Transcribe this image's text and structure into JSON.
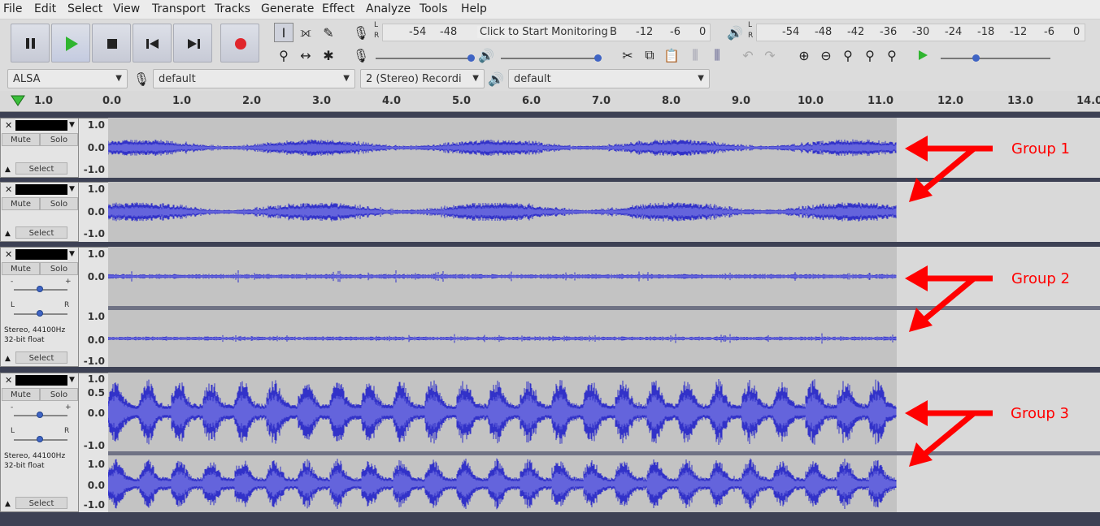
{
  "menu": [
    "File",
    "Edit",
    "Select",
    "View",
    "Transport",
    "Tracks",
    "Generate",
    "Effect",
    "Analyze",
    "Tools",
    "Help"
  ],
  "transport": [
    "pause",
    "play",
    "stop",
    "skip-start",
    "skip-end",
    "record"
  ],
  "meters": {
    "record_scale": [
      "-54",
      "-48",
      "Click to Start Monitoring",
      "-12",
      "-6",
      "0"
    ],
    "playback_scale": [
      "-54",
      "-48",
      "-42",
      "-36",
      "-30",
      "-24",
      "-18",
      "-12",
      "-6",
      "0"
    ],
    "lr": [
      "L",
      "R"
    ]
  },
  "devices": {
    "host": "ALSA",
    "record_device": "default",
    "channels": "2 (Stereo) Recordi",
    "playback_device": "default"
  },
  "ruler_ticks": [
    "1.0",
    "0.0",
    "1.0",
    "2.0",
    "3.0",
    "4.0",
    "5.0",
    "6.0",
    "7.0",
    "8.0",
    "9.0",
    "10.0",
    "11.0",
    "12.0",
    "13.0",
    "14.0"
  ],
  "track_panel": {
    "mute": "Mute",
    "solo": "Solo",
    "select": "Select",
    "gain_minus": "-",
    "gain_plus": "+",
    "pan_l": "L",
    "pan_r": "R",
    "info_line1": "Stereo, 44100Hz",
    "info_line2": "32-bit float"
  },
  "scale_labels": {
    "one": "1.0",
    "zero": "0.0",
    "minus": "-1.0",
    "half": "0.5"
  },
  "annotations": [
    "Group 1",
    "Group 2",
    "Group 3"
  ],
  "colors": {
    "wave": "#3232c8",
    "wave_rms": "#6464dc",
    "annot": "#ff0000"
  }
}
